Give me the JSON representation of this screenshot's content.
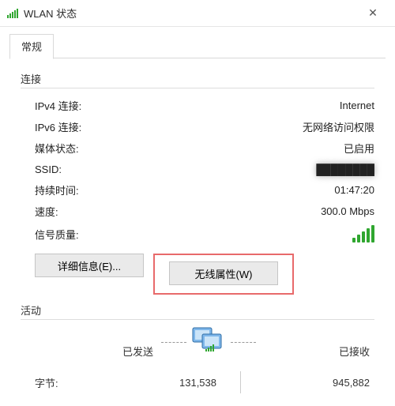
{
  "window": {
    "title": "WLAN 状态",
    "close_glyph": "✕"
  },
  "tabs": {
    "general": "常规"
  },
  "groups": {
    "connection": "连接",
    "activity": "活动"
  },
  "connection": {
    "ipv4_label": "IPv4 连接:",
    "ipv4_value": "Internet",
    "ipv6_label": "IPv6 连接:",
    "ipv6_value": "无网络访问权限",
    "media_label": "媒体状态:",
    "media_value": "已启用",
    "ssid_label": "SSID:",
    "ssid_value": "████████",
    "duration_label": "持续时间:",
    "duration_value": "01:47:20",
    "speed_label": "速度:",
    "speed_value": "300.0 Mbps",
    "signal_label": "信号质量:"
  },
  "buttons": {
    "details": "详细信息(E)...",
    "wireless_props": "无线属性(W)"
  },
  "activity": {
    "sent": "已发送",
    "received": "已接收",
    "bytes_label": "字节:",
    "bytes_sent": "131,538",
    "bytes_received": "945,882"
  }
}
